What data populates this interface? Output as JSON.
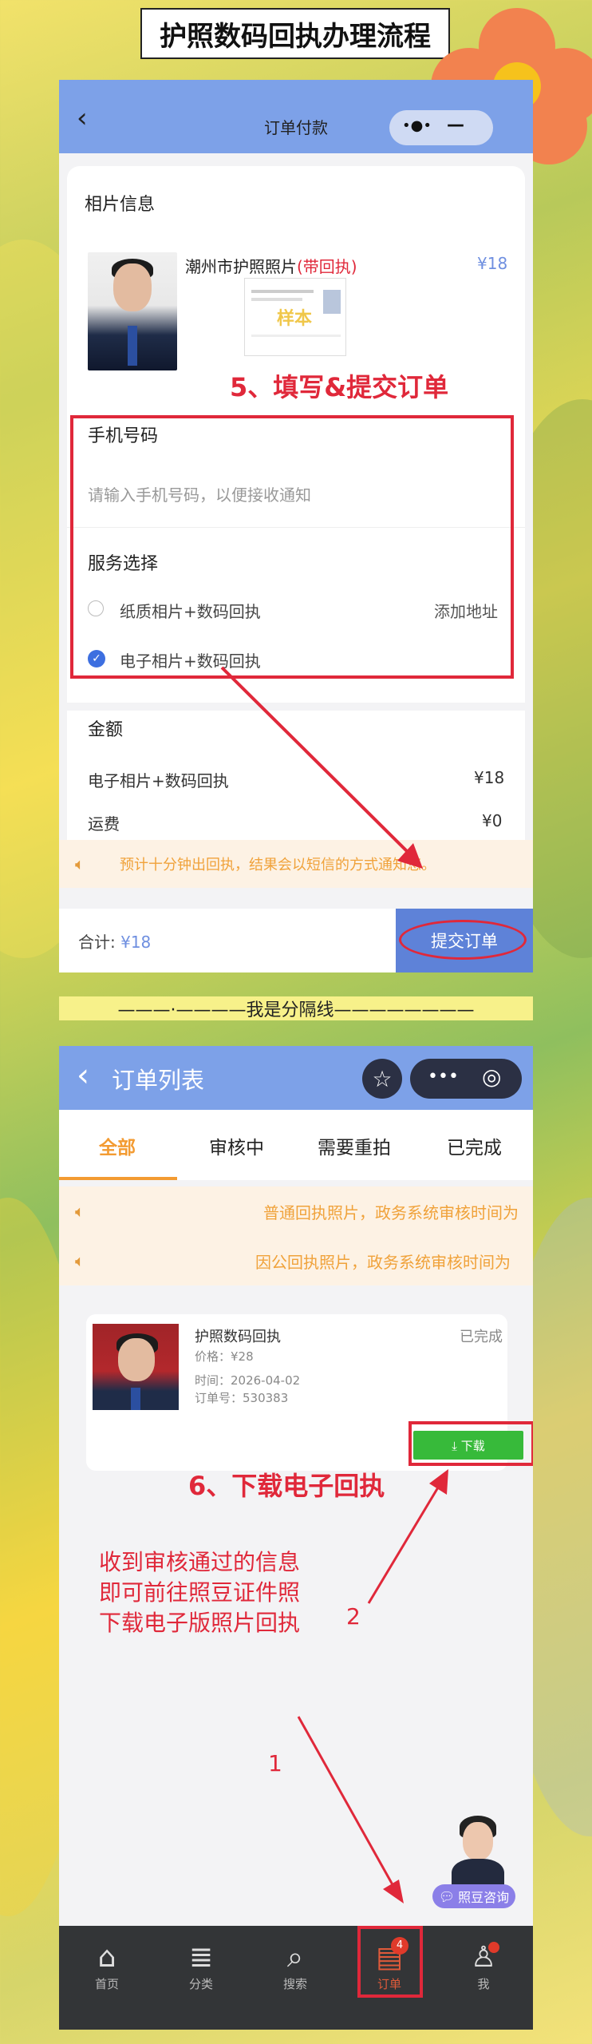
{
  "header": {
    "title": "护照数码回执办理流程"
  },
  "screen1": {
    "nav_title": "订单付款",
    "nav_back": "‹",
    "capsule_dots": "•●•",
    "capsule_minus": "—",
    "photo_info_label": "相片信息",
    "product_name": "潮州市护照照片",
    "product_tag": "(带回执)",
    "price": "¥18",
    "watermark": "样本",
    "step_label": "5、填写&提交订单",
    "phone_label": "手机号码",
    "phone_placeholder": "请输入手机号码，以便接收通知",
    "service_label": "服务选择",
    "service_options": [
      {
        "label": "纸质相片+数码回执",
        "action": "添加地址"
      },
      {
        "label": "电子相片+数码回执"
      }
    ],
    "amount_label": "金额",
    "amount_rows": [
      {
        "label": "电子相片+数码回执",
        "value": "¥18"
      },
      {
        "label": "运费",
        "value": "¥0"
      }
    ],
    "hint": "预计十分钟出回执，结果会以短信的方式通知您。",
    "total_label": "合计:",
    "total_value": "¥18",
    "submit_label": "提交订单"
  },
  "divider": {
    "text": "———·————我是分隔线————————"
  },
  "screen2": {
    "nav_back": "‹",
    "nav_title": "订单列表",
    "star_icon": "☆",
    "capsule_dots": "•••",
    "capsule_circle": "◎",
    "tabs": [
      "全部",
      "审核中",
      "需要重拍",
      "已完成"
    ],
    "notices": [
      "普通回执照片，政务系统审核时间为",
      "因公回执照片，政务系统审核时间为"
    ],
    "order": {
      "title": "护照数码回执",
      "status": "已完成",
      "price": "价格：¥28",
      "time": "时间：2026-04-02",
      "order_no": "订单号：530383",
      "download_label": "⤓ 下载"
    },
    "step_label": "6、下载电子回执",
    "annotation": [
      "收到审核通过的信息",
      "即可前往照豆证件照",
      "下载电子版照片回执"
    ],
    "marker_2": "2",
    "marker_1": "1",
    "consult_label": "照豆咨询",
    "tabbar": [
      {
        "label": "首页",
        "icon": "⌂"
      },
      {
        "label": "分类",
        "icon": "≣"
      },
      {
        "label": "搜索",
        "icon": "⌕"
      },
      {
        "label": "订单",
        "icon": "▤",
        "badge": "4"
      },
      {
        "label": "我",
        "icon": "♙"
      }
    ]
  }
}
